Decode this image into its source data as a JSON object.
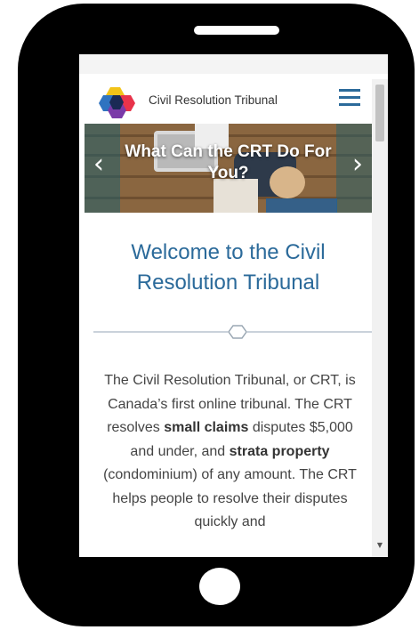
{
  "header": {
    "site_name": "Civil Resolution Tribunal",
    "logo": "crt-logo",
    "menu_icon": "hamburger-menu-icon"
  },
  "hero": {
    "title": "What Can the CRT Do For You?",
    "prev_icon": "chevron-left-icon",
    "next_icon": "chevron-right-icon",
    "prev_glyph": "‹",
    "next_glyph": "›"
  },
  "welcome": {
    "heading": "Welcome to the Civil Resolution Tribunal"
  },
  "intro": {
    "part1": "The Civil Resolution Tribunal, or CRT, is Canada’s first online tribunal. The CRT resolves ",
    "bold1": "small claims",
    "part2": " disputes $5,000 and under, and ",
    "bold2": "strata property",
    "part3": " (condominium) of any amount. The CRT helps people to resolve their disputes quickly and"
  },
  "colors": {
    "accent": "#2b6a9a",
    "phone_frame": "#000000",
    "divider": "#b8c4cf"
  }
}
